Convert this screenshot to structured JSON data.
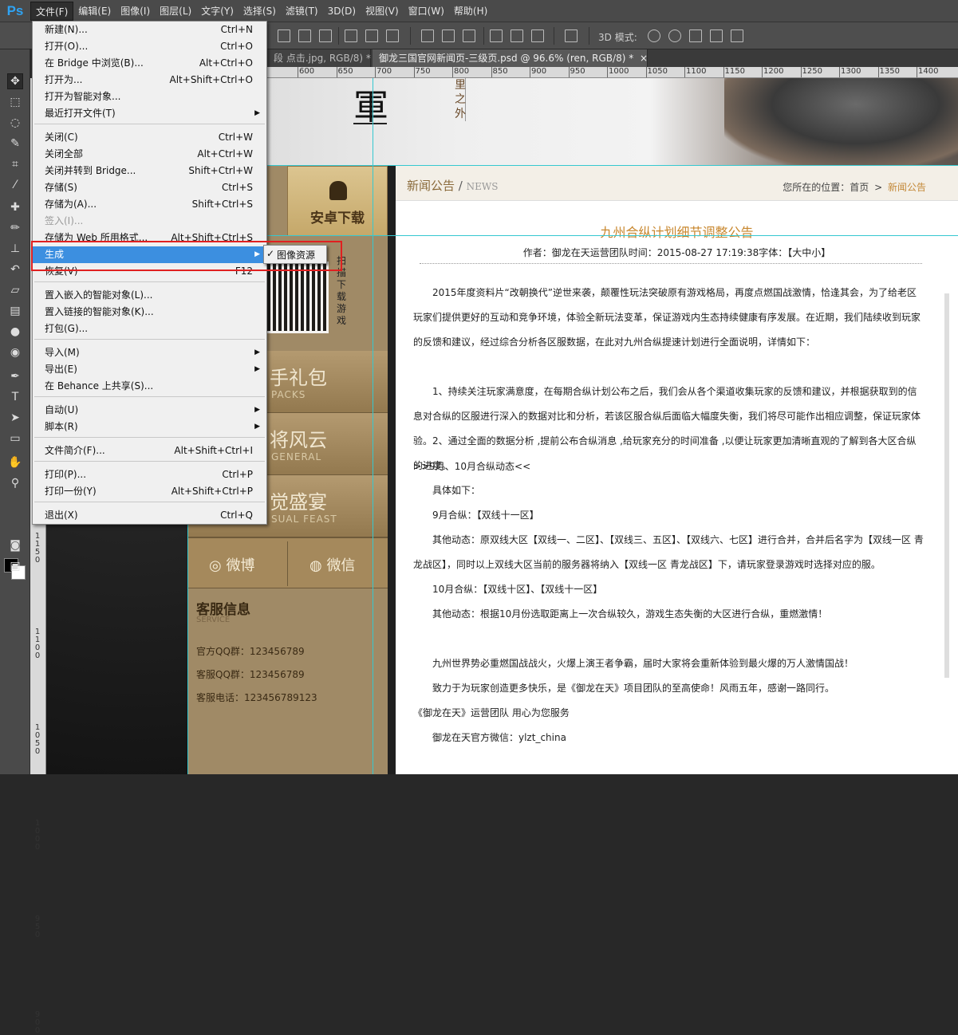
{
  "app": {
    "logo": "Ps"
  },
  "menubar": [
    "文件(F)",
    "编辑(E)",
    "图像(I)",
    "图层(L)",
    "文字(Y)",
    "选择(S)",
    "滤镜(T)",
    "3D(D)",
    "视图(V)",
    "窗口(W)",
    "帮助(H)"
  ],
  "options": {
    "mode3d": "3D 模式:"
  },
  "tabs": [
    {
      "label": "段 点击.jpg, RGB/8) *",
      "close": "×"
    },
    {
      "label": "御龙三国官网新闻页-三级页.psd @ 96.6% (ren, RGB/8) *",
      "close": "×"
    }
  ],
  "ruler_top": [
    "600",
    "650",
    "700",
    "750",
    "800",
    "850",
    "900",
    "950",
    "1000",
    "1050",
    "1100",
    "1150",
    "1200",
    "1250",
    "1300",
    "1350",
    "1400"
  ],
  "ruler_left": [
    "1150",
    "1100",
    "1050",
    "1000",
    "950",
    "900"
  ],
  "file_menu": {
    "items": [
      {
        "label": "新建(N)...",
        "shortcut": "Ctrl+N"
      },
      {
        "label": "打开(O)...",
        "shortcut": "Ctrl+O"
      },
      {
        "label": "在 Bridge 中浏览(B)...",
        "shortcut": "Alt+Ctrl+O"
      },
      {
        "label": "打开为...",
        "shortcut": "Alt+Shift+Ctrl+O"
      },
      {
        "label": "打开为智能对象...",
        "shortcut": ""
      },
      {
        "label": "最近打开文件(T)",
        "shortcut": "",
        "submenu": true
      },
      {
        "label": "关闭(C)",
        "shortcut": "Ctrl+W"
      },
      {
        "label": "关闭全部",
        "shortcut": "Alt+Ctrl+W"
      },
      {
        "label": "关闭并转到 Bridge...",
        "shortcut": "Shift+Ctrl+W"
      },
      {
        "label": "存储(S)",
        "shortcut": "Ctrl+S"
      },
      {
        "label": "存储为(A)...",
        "shortcut": "Shift+Ctrl+S"
      },
      {
        "label": "签入(I)...",
        "shortcut": "",
        "disabled": true
      },
      {
        "label": "存储为 Web 所用格式...",
        "shortcut": "Alt+Shift+Ctrl+S"
      },
      {
        "label": "生成",
        "shortcut": "",
        "submenu": true,
        "highlighted": true
      },
      {
        "label": "恢复(V)",
        "shortcut": "F12"
      },
      {
        "label": "置入嵌入的智能对象(L)...",
        "shortcut": ""
      },
      {
        "label": "置入链接的智能对象(K)...",
        "shortcut": ""
      },
      {
        "label": "打包(G)...",
        "shortcut": ""
      },
      {
        "label": "导入(M)",
        "shortcut": "",
        "submenu": true
      },
      {
        "label": "导出(E)",
        "shortcut": "",
        "submenu": true
      },
      {
        "label": "在 Behance 上共享(S)...",
        "shortcut": ""
      },
      {
        "label": "自动(U)",
        "shortcut": "",
        "submenu": true
      },
      {
        "label": "脚本(R)",
        "shortcut": "",
        "submenu": true
      },
      {
        "label": "文件简介(F)...",
        "shortcut": "Alt+Shift+Ctrl+I"
      },
      {
        "label": "打印(P)...",
        "shortcut": "Ctrl+P"
      },
      {
        "label": "打印一份(Y)",
        "shortcut": "Alt+Shift+Ctrl+P"
      },
      {
        "label": "退出(X)",
        "shortcut": "Ctrl+Q"
      }
    ],
    "submenu_check": "✓",
    "submenu_item": "图像资源",
    "submenu_arrow": "▶"
  },
  "webpage": {
    "banner_char": "軍",
    "banner_vtext": "里之外",
    "android_label": "安卓下载",
    "qr_text": "扫描下载游戏",
    "blocks": [
      {
        "title": "手礼包",
        "sub": "PACKS"
      },
      {
        "title": "将风云",
        "sub": "GENERAL"
      },
      {
        "title": "觉盛宴",
        "sub": "SUAL FEAST"
      }
    ],
    "weibo": "微博",
    "weixin": "微信",
    "service_title": "客服信息",
    "service_sub": "SERVICE",
    "service_lines": [
      "官方QQ群：123456789",
      "客服QQ群：123456789",
      "客服电话：123456789123"
    ]
  },
  "article": {
    "section": "新闻公告",
    "section_sep": "/",
    "section_en": "NEWS",
    "breadcrumb_prefix": "您所在的位置：首页",
    "breadcrumb_arrow": ">",
    "breadcrumb_current": "新闻公告",
    "title": "九州合纵计划细节调整公告",
    "meta": "作者：御龙在天运营团队时间：2015-08-27 17:19:38字体：【大中小】",
    "paragraphs": [
      "　　2015年度资料片“改朝换代”逆世来袭，颠覆性玩法突破原有游戏格局，再度点燃国战激情，恰逢其会，为了给老区玩家们提供更好的互动和竞争环境，体验全新玩法变革，保证游戏内生态持续健康有序发展。在近期，我们陆续收到玩家的反馈和建议，经过综合分析各区服数据，在此对九州合纵提速计划进行全面说明，详情如下：",
      "　　1、持续关注玩家满意度，在每期合纵计划公布之后，我们会从各个渠道收集玩家的反馈和建议，并根据获取到的信息对合纵的区服进行深入的数据对比和分析，若该区服合纵后面临大幅度失衡，我们将尽可能作出相应调整，保证玩家体验。",
      "　　2、通过全面的数据分析 ,提前公布合纵消息 ,给玩家充分的时间准备 ,以便让玩家更加清晰直观的了解到各大区合纵的进度。",
      ">>9月、10月合纵动态<<",
      "　　具体如下：",
      "　　9月合纵：【双线十一区】",
      "　　其他动态：原双线大区【双线一、二区】、【双线三、五区】、【双线六、七区】进行合并，合并后名字为【双线一区 青龙战区】，同时以上双线大区当前的服务器将纳入【双线一区 青龙战区】下，请玩家登录游戏时选择对应的服。",
      "　　10月合纵：【双线十区】、【双线十一区】",
      "　　其他动态：根据10月份选取距离上一次合纵较久，游戏生态失衡的大区进行合纵，重燃激情！",
      "　　九州世界势必重燃国战战火，火爆上演王者争霸，届时大家将会重新体验到最火爆的万人激情国战！",
      "　　致力于为玩家创造更多快乐，是《御龙在天》项目团队的至高使命！风雨五年，感谢一路同行。",
      "《御龙在天》运营团队 用心为您服务",
      "　　御龙在天官方微信：ylzt_china"
    ]
  }
}
